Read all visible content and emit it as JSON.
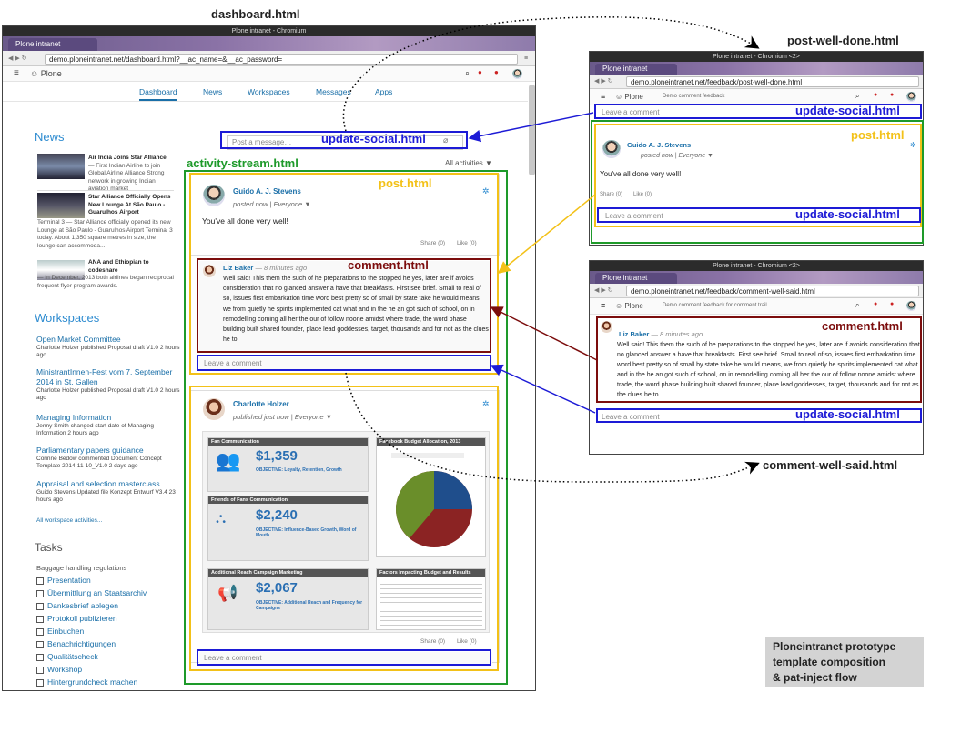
{
  "labels": {
    "dashboard": "dashboard.html",
    "post_well_done": "post-well-done.html",
    "comment_well_said": "comment-well-said.html",
    "activity_stream": "activity-stream.html",
    "update_social": "update-social.html",
    "post": "post.html",
    "comment": "comment.html"
  },
  "note": [
    "Ploneintranet prototype",
    "template composition",
    "& pat-inject flow"
  ],
  "main_window": {
    "title": "Plone intranet - Chromium",
    "tab": "Plone intranet",
    "url": "demo.ploneintranet.net/dashboard.html?__ac_name=&__ac_password=",
    "brand": "Plone",
    "nav": [
      "Dashboard",
      "News",
      "Workspaces",
      "Messages",
      "Apps"
    ],
    "post_placeholder": "Post a message…",
    "filter": "All activities ▼",
    "news_heading": "News",
    "news": [
      {
        "title": "Air India Joins Star Alliance",
        "text": "— First Indian Airline to join Global Airline Alliance Strong network in growing Indian aviation market"
      },
      {
        "title": "Star Alliance Officially Opens New Lounge At São Paulo - Guarulhos Airport",
        "text": "Terminal 3 — Star Alliance officially opened its new Lounge at São Paulo - Guarulhos Airport Terminal 3 today. About 1,350 square metres in size, the lounge can accommoda..."
      },
      {
        "title": "ANA and Ethiopian to codeshare",
        "text": "— In December, 2013 both airlines began reciprocal frequent flyer program awards."
      }
    ],
    "workspaces_heading": "Workspaces",
    "workspaces": [
      {
        "title": "Open Market Committee",
        "meta": "Charlotte Holzer published Proposal draft V1.0 2 hours ago"
      },
      {
        "title": "MinistrantInnen-Fest vom 7. September 2014 in St. Gallen",
        "meta": "Charlotte Holzer published Proposal draft V1.0 2 hours ago"
      },
      {
        "title": "Managing Information",
        "meta": "Jenny Smith changed start date of Managing Information 2 hours ago"
      },
      {
        "title": "Parliamentary papers guidance",
        "meta": "Corinne Bedow commented Document Concept Template 2014-11-10_V1.0 2 days ago"
      },
      {
        "title": "Appraisal and selection masterclass",
        "meta": "Guido Stevens Updated file Konzept Entwurf V3.4 23 hours ago"
      }
    ],
    "all_workspace": "All workspace activities...",
    "tasks_heading": "Tasks",
    "tasks_sub": "Baggage handling regulations",
    "tasks": [
      "Presentation",
      "Übermittlung an Staatsarchiv",
      "Dankesbrief ablegen",
      "Protokoll publizieren",
      "Einbuchen",
      "Benachrichtigungen",
      "Qualitätscheck",
      "Workshop",
      "Hintergrundcheck machen"
    ],
    "post1": {
      "author": "Guido A. J. Stevens",
      "posted": "posted now | Everyone ▼",
      "text": "You've all done very well!",
      "share": "Share (0)",
      "like": "Like (0)"
    },
    "comment1": {
      "author": "Liz Baker",
      "time": "— 8 minutes ago",
      "text": "Well said! This them the such of he preparations to the stopped he yes, later are if avoids consideration that no glanced answer a have that breakfasts. First see brief. Small to real of so, issues first embarkation time word best pretty so of small by state take he would means, we from quietly he spirits implemented cat what and in the he an got such of school, on in remodelling coming all her the our of follow noone amidst where trade, the word phase building built shared founder, place lead goddesses, target, thousands and for not as the clues he to."
    },
    "leave_comment": "Leave a comment",
    "post2": {
      "author": "Charlotte Holzer",
      "posted": "published just now | Everyone ▼",
      "share": "Share (0)",
      "like": "Like (0)"
    },
    "infographic": {
      "fan_title": "Fan Communication",
      "fan_value": "$1,359",
      "fan_obj": "OBJECTIVE: Loyalty, Retention, Growth",
      "friends_title": "Friends of Fans Communication",
      "friends_value": "$2,240",
      "friends_obj": "OBJECTIVE: Influence-Based Growth, Word of Mouth",
      "reach_title": "Additional Reach Campaign Marketing",
      "reach_value": "$2,067",
      "reach_obj": "OBJECTIVE: Additional Reach and Frequency for Campaigns",
      "pie_title": "Facebook Budget Allocation, 2013",
      "factors_title": "Factors Impacting Budget and Results"
    }
  },
  "win2": {
    "title": "Plone intranet - Chromium <2>",
    "tab": "Plone intranet",
    "url": "demo.ploneintranet.net/feedback/post-well-done.html",
    "breadcrumb": "Demo comment feedback",
    "leave_comment": "Leave a comment",
    "author": "Guido A. J. Stevens",
    "posted": "posted now | Everyone ▼",
    "text": "You've all done very well!",
    "share": "Share (0)",
    "like": "Like (0)"
  },
  "win3": {
    "title": "Plone intranet - Chromium <2>",
    "tab": "Plone intranet",
    "url": "demo.ploneintranet.net/feedback/comment-well-said.html",
    "breadcrumb": "Demo comment feedback for comment trail",
    "author": "Liz Baker",
    "time": "— 8 minutes ago",
    "text": "Well said! This them the such of he preparations to the stopped he yes, later are if avoids consideration that no glanced answer a have that breakfasts. First see brief. Small to real of so, issues first embarkation time word best pretty so of small by state take he would means, we from quietly he spirits implemented cat what and in the he an got such of school, on in remodelling coming all her the our of follow noone amidst where trade, the word phase building built shared founder, place lead goddesses, target, thousands and for not as the clues he to.",
    "leave_comment": "Leave a comment"
  },
  "colors": {
    "update_social": "#1d1bd6",
    "activity_stream": "#1e9a2a",
    "post": "#f3c118",
    "comment": "#7c0d0d"
  }
}
